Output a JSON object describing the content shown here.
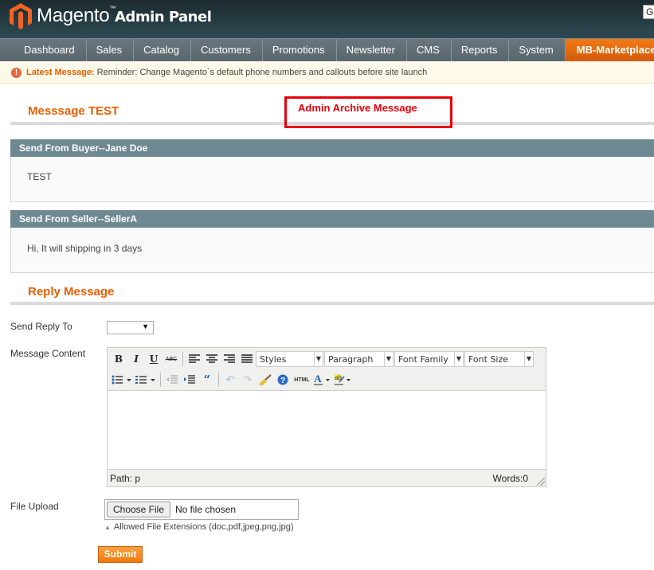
{
  "header": {
    "brand": "Magento",
    "brand_sub": "Admin Panel",
    "global_search_value": "Gl"
  },
  "nav": {
    "items": [
      {
        "label": "Dashboard"
      },
      {
        "label": "Sales"
      },
      {
        "label": "Catalog"
      },
      {
        "label": "Customers"
      },
      {
        "label": "Promotions"
      },
      {
        "label": "Newsletter"
      },
      {
        "label": "CMS"
      },
      {
        "label": "Reports"
      },
      {
        "label": "System"
      },
      {
        "label": "MB-Marketplace",
        "active": true
      }
    ]
  },
  "notice": {
    "icon": "exclamation-icon",
    "label": "Latest Message:",
    "text": " Reminder: Change Magento`s default phone numbers and callouts before site launch"
  },
  "page": {
    "title": "Messsage TEST",
    "archive_label": "Admin Archive Message"
  },
  "messages": [
    {
      "header": "Send From Buyer--Jane Doe",
      "body": "TEST"
    },
    {
      "header": "Send From Seller--SellerA",
      "body": "Hi, It will shipping in 3 days"
    }
  ],
  "reply": {
    "title": "Reply Message",
    "send_to_label": "Send Reply To",
    "send_to_value": "",
    "content_label": "Message Content",
    "editor": {
      "styles": "Styles",
      "paragraph": "Paragraph",
      "font_family": "Font Family",
      "font_size": "Font Size",
      "path": "Path: p",
      "words": "Words:0",
      "html_label": "HTML"
    },
    "file_label": "File Upload",
    "choose_file": "Choose File",
    "no_file": "No file chosen",
    "allowed_ext": "Allowed File Extensions (doc,pdf,jpeg,png,jpg)",
    "submit": "Submit"
  }
}
